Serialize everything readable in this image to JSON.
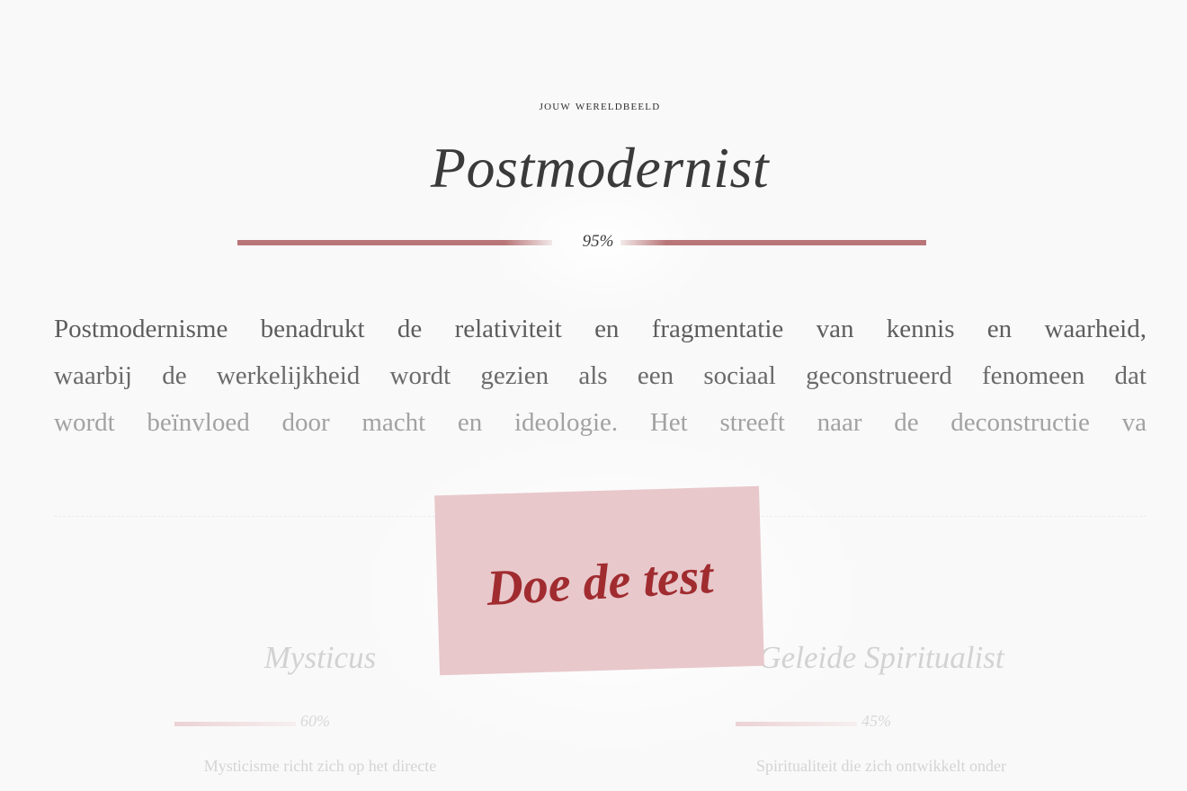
{
  "result": {
    "eyebrow": "JOUW WERELDBEELD",
    "title": "Postmodernist",
    "score_label": "95%",
    "score_value": 95,
    "accent_color": "#b87678"
  },
  "description": {
    "line1": "Postmodernisme benadrukt de relativiteit en fragmentatie van kennis en waarheid,",
    "line2": "waarbij de werkelijkheid wordt gezien als een sociaal geconstrueerd fenomeen dat",
    "line3": "wordt beïnvloed door macht en ideologie. Het streeft naar de deconstructie va"
  },
  "cta": {
    "label": "Doe de test",
    "bg_color": "#e8c8cb",
    "text_color": "#a02c30"
  },
  "alternatives": [
    {
      "name": "Mysticus",
      "score_label": "60%",
      "score_value": 60,
      "description": "Mysticisme richt zich op het directe"
    },
    {
      "name": "Geleide Spiritualist",
      "score_label": "45%",
      "score_value": 45,
      "description": "Spiritualiteit die zich ontwikkelt onder"
    }
  ]
}
